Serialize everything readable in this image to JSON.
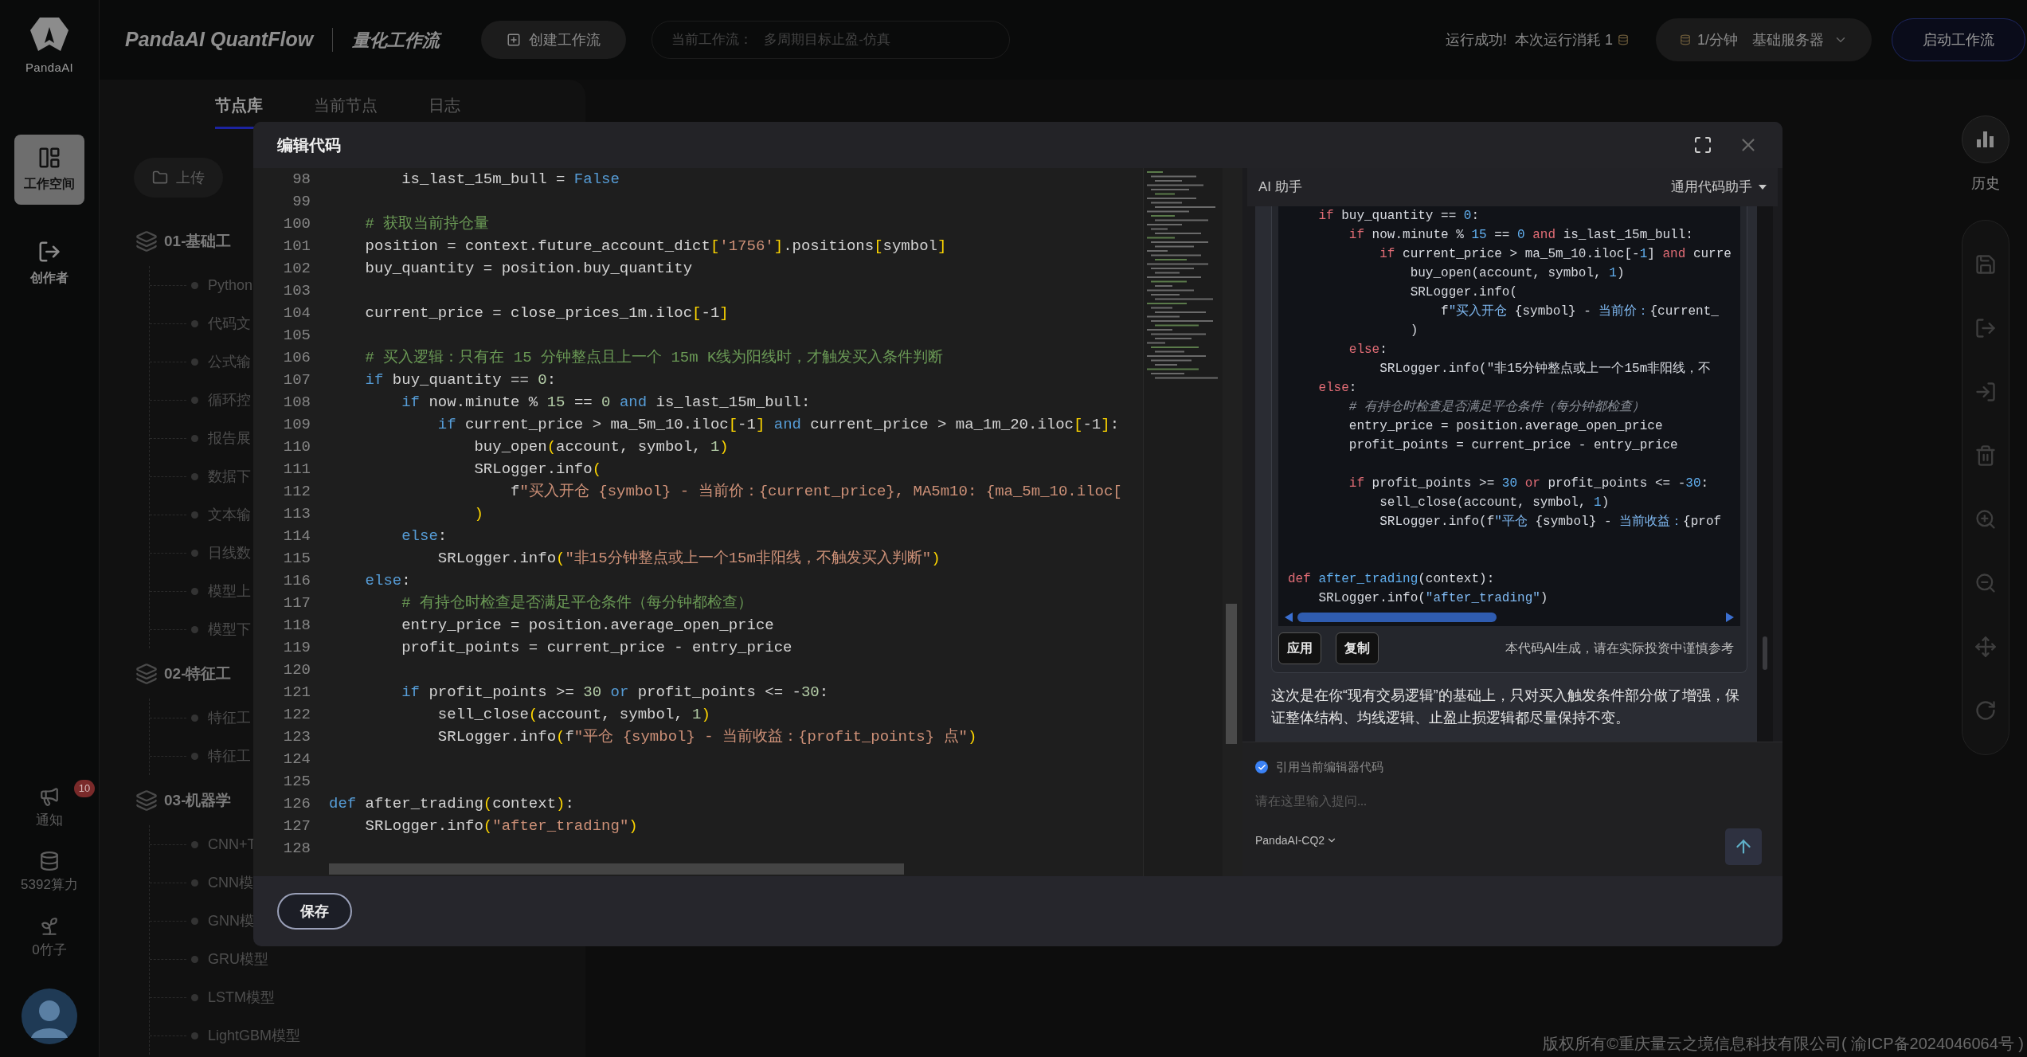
{
  "sidebar": {
    "logo_text": "PandaAI",
    "items": [
      {
        "label": "工作空间",
        "selected": true,
        "kind": "workspace"
      },
      {
        "label": "创作者",
        "selected": false,
        "kind": "creator"
      }
    ],
    "bottom_items": [
      {
        "kind": "notify",
        "label": "通知",
        "badge": "10"
      },
      {
        "kind": "compute",
        "label": "5392算力"
      },
      {
        "kind": "bamboo",
        "label": "0竹子"
      }
    ]
  },
  "header": {
    "title": "PandaAI QuantFlow",
    "subtitle": "量化工作流",
    "create_button": "创建工作流",
    "current_workflow": {
      "label": "当前工作流：",
      "value": "多周期目标止盈-仿真"
    },
    "run_status": "运行成功!  本次运行消耗 1",
    "server": {
      "rate": "1/分钟",
      "name": "基础服务器"
    },
    "start_button": "启动工作流"
  },
  "node_panel": {
    "tabs": [
      {
        "label": "节点库",
        "selected": true
      },
      {
        "label": "当前节点",
        "selected": false
      },
      {
        "label": "日志",
        "selected": false
      }
    ],
    "upload_button": "上传",
    "groups": [
      {
        "title": "01-基础工",
        "items": [
          "Python",
          "代码文",
          "公式输",
          "循环控",
          "报告展",
          "数据下",
          "文本输",
          "日线数",
          "模型上",
          "模型下"
        ]
      },
      {
        "title": "02-特征工",
        "items": [
          "特征工",
          "特征工"
        ]
      },
      {
        "title": "03-机器学",
        "items": [
          "CNN+T",
          "CNN模",
          "GNN模",
          "GRU模型",
          "LSTM模型",
          "LightGBM模型"
        ]
      }
    ]
  },
  "right_toolbar": {
    "history_label": "历史"
  },
  "dialog": {
    "title": "编辑代码",
    "editor": {
      "lines": [
        {
          "no": "98",
          "tokens": [
            {
              "kind": "plain",
              "text": "        is_last_15m_bull = "
            },
            {
              "kind": "kw",
              "text": "False"
            }
          ]
        },
        {
          "no": "99"
        },
        {
          "no": "100",
          "tokens": [
            {
              "kind": "cm",
              "text": "    # 获取当前持仓量"
            }
          ]
        },
        {
          "no": "101",
          "tokens": [
            {
              "kind": "plain",
              "text": "    position = context.future_account_dict"
            },
            {
              "kind": "br",
              "text": "["
            },
            {
              "kind": "str",
              "text": "'1756'"
            },
            {
              "kind": "br",
              "text": "]"
            },
            {
              "kind": "plain",
              "text": ".positions"
            },
            {
              "kind": "br",
              "text": "["
            },
            {
              "kind": "plain",
              "text": "symbol"
            },
            {
              "kind": "br",
              "text": "]"
            }
          ]
        },
        {
          "no": "102",
          "tokens": [
            {
              "kind": "plain",
              "text": "    buy_quantity = position.buy_quantity"
            }
          ]
        },
        {
          "no": "103"
        },
        {
          "no": "104",
          "tokens": [
            {
              "kind": "plain",
              "text": "    current_price = close_prices_1m.iloc"
            },
            {
              "kind": "br",
              "text": "["
            },
            {
              "kind": "plain",
              "text": "-1"
            },
            {
              "kind": "br",
              "text": "]"
            }
          ]
        },
        {
          "no": "105"
        },
        {
          "no": "106",
          "tokens": [
            {
              "kind": "cm",
              "text": "    # 买入逻辑：只有在 15 分钟整点且上一个 15m K线为阳线时，才触发买入条件判断"
            }
          ]
        },
        {
          "no": "107",
          "tokens": [
            {
              "kind": "kw",
              "text": "    if"
            },
            {
              "kind": "plain",
              "text": " buy_quantity == "
            },
            {
              "kind": "num",
              "text": "0"
            },
            {
              "kind": "plain",
              "text": ":"
            }
          ]
        },
        {
          "no": "108",
          "tokens": [
            {
              "kind": "kw",
              "text": "        if"
            },
            {
              "kind": "plain",
              "text": " now.minute % "
            },
            {
              "kind": "num",
              "text": "15"
            },
            {
              "kind": "plain",
              "text": " == "
            },
            {
              "kind": "num",
              "text": "0"
            },
            {
              "kind": "kw",
              "text": " and"
            },
            {
              "kind": "plain",
              "text": " is_last_15m_bull:"
            }
          ]
        },
        {
          "no": "109",
          "tokens": [
            {
              "kind": "kw",
              "text": "            if"
            },
            {
              "kind": "plain",
              "text": " current_price > ma_5m_10.iloc"
            },
            {
              "kind": "br",
              "text": "["
            },
            {
              "kind": "plain",
              "text": "-1"
            },
            {
              "kind": "br",
              "text": "]"
            },
            {
              "kind": "kw",
              "text": " and"
            },
            {
              "kind": "plain",
              "text": " current_price > ma_1m_20.iloc"
            },
            {
              "kind": "br",
              "text": "["
            },
            {
              "kind": "plain",
              "text": "-1"
            },
            {
              "kind": "br",
              "text": "]"
            },
            {
              "kind": "plain",
              "text": ":"
            }
          ]
        },
        {
          "no": "110",
          "tokens": [
            {
              "kind": "plain",
              "text": "                buy_open"
            },
            {
              "kind": "br",
              "text": "("
            },
            {
              "kind": "plain",
              "text": "account, symbol, "
            },
            {
              "kind": "num",
              "text": "1"
            },
            {
              "kind": "br",
              "text": ")"
            }
          ]
        },
        {
          "no": "111",
          "tokens": [
            {
              "kind": "plain",
              "text": "                SRLogger.info"
            },
            {
              "kind": "br",
              "text": "("
            }
          ]
        },
        {
          "no": "112",
          "tokens": [
            {
              "kind": "plain",
              "text": "                    f"
            },
            {
              "kind": "str",
              "text": "\"买入开仓 {symbol} - 当前价：{current_price}, MA5m10: {ma_5m_10.iloc["
            }
          ]
        },
        {
          "no": "113",
          "tokens": [
            {
              "kind": "br",
              "text": "                )"
            }
          ]
        },
        {
          "no": "114",
          "tokens": [
            {
              "kind": "kw",
              "text": "        else"
            },
            {
              "kind": "plain",
              "text": ":"
            }
          ]
        },
        {
          "no": "115",
          "tokens": [
            {
              "kind": "plain",
              "text": "            SRLogger.info"
            },
            {
              "kind": "br",
              "text": "("
            },
            {
              "kind": "str",
              "text": "\"非15分钟整点或上一个15m非阳线，不触发买入判断\""
            },
            {
              "kind": "br",
              "text": ")"
            }
          ]
        },
        {
          "no": "116",
          "tokens": [
            {
              "kind": "kw",
              "text": "    else"
            },
            {
              "kind": "plain",
              "text": ":"
            }
          ]
        },
        {
          "no": "117",
          "tokens": [
            {
              "kind": "cm",
              "text": "        # 有持仓时检查是否满足平仓条件（每分钟都检查）"
            }
          ]
        },
        {
          "no": "118",
          "tokens": [
            {
              "kind": "plain",
              "text": "        entry_price = position.average_open_price"
            }
          ]
        },
        {
          "no": "119",
          "tokens": [
            {
              "kind": "plain",
              "text": "        profit_points = current_price - entry_price"
            }
          ]
        },
        {
          "no": "120"
        },
        {
          "no": "121",
          "tokens": [
            {
              "kind": "kw",
              "text": "        if"
            },
            {
              "kind": "plain",
              "text": " profit_points >= "
            },
            {
              "kind": "num",
              "text": "30"
            },
            {
              "kind": "kw",
              "text": " or"
            },
            {
              "kind": "plain",
              "text": " profit_points <= -"
            },
            {
              "kind": "num",
              "text": "30"
            },
            {
              "kind": "plain",
              "text": ":"
            }
          ]
        },
        {
          "no": "122",
          "tokens": [
            {
              "kind": "plain",
              "text": "            sell_close"
            },
            {
              "kind": "br",
              "text": "("
            },
            {
              "kind": "plain",
              "text": "account, symbol, "
            },
            {
              "kind": "num",
              "text": "1"
            },
            {
              "kind": "br",
              "text": ")"
            }
          ]
        },
        {
          "no": "123",
          "tokens": [
            {
              "kind": "plain",
              "text": "            SRLogger.info"
            },
            {
              "kind": "br",
              "text": "("
            },
            {
              "kind": "plain",
              "text": "f"
            },
            {
              "kind": "str",
              "text": "\"平仓 {symbol} - 当前收益：{profit_points} 点\""
            },
            {
              "kind": "br",
              "text": ")"
            }
          ]
        },
        {
          "no": "124"
        },
        {
          "no": "125"
        },
        {
          "no": "126",
          "tokens": [
            {
              "kind": "kw",
              "text": "def"
            },
            {
              "kind": "plain",
              "text": " after_trading"
            },
            {
              "kind": "br",
              "text": "("
            },
            {
              "kind": "plain",
              "text": "context"
            },
            {
              "kind": "br",
              "text": ")"
            },
            {
              "kind": "plain",
              "text": ":"
            }
          ]
        },
        {
          "no": "127",
          "tokens": [
            {
              "kind": "plain",
              "text": "    SRLogger.info"
            },
            {
              "kind": "br",
              "text": "("
            },
            {
              "kind": "str",
              "text": "\"after_trading\""
            },
            {
              "kind": "br",
              "text": ")"
            }
          ]
        },
        {
          "no": "128"
        }
      ]
    },
    "assistant": {
      "title": "AI 助手",
      "mode": "通用代码助手",
      "code_lines": [
        {
          "kind": "code",
          "tokens": [
            {
              "kind": "kw",
              "text": "    if"
            },
            {
              "kind": "plain",
              "text": " buy_quantity == "
            },
            {
              "kind": "num",
              "text": "0"
            },
            {
              "kind": "plain",
              "text": ":"
            }
          ]
        },
        {
          "kind": "code",
          "tokens": [
            {
              "kind": "kw",
              "text": "        if"
            },
            {
              "kind": "plain",
              "text": " now.minute % "
            },
            {
              "kind": "num",
              "text": "15"
            },
            {
              "kind": "plain",
              "text": " == "
            },
            {
              "kind": "num",
              "text": "0"
            },
            {
              "kind": "kw",
              "text": " and"
            },
            {
              "kind": "plain",
              "text": " is_last_15m_bull:"
            }
          ]
        },
        {
          "kind": "code",
          "tokens": [
            {
              "kind": "kw",
              "text": "            if"
            },
            {
              "kind": "plain",
              "text": " current_price > ma_5m_10.iloc[-"
            },
            {
              "kind": "num",
              "text": "1"
            },
            {
              "kind": "plain",
              "text": "]"
            },
            {
              "kind": "kw",
              "text": " and"
            },
            {
              "kind": "plain",
              "text": " curre"
            }
          ]
        },
        {
          "kind": "code",
          "tokens": [
            {
              "kind": "plain",
              "text": "                buy_open(account, symbol, "
            },
            {
              "kind": "num",
              "text": "1"
            },
            {
              "kind": "plain",
              "text": ")"
            }
          ]
        },
        {
          "kind": "code",
          "tokens": [
            {
              "kind": "plain",
              "text": "                SRLogger.info("
            }
          ]
        },
        {
          "kind": "code",
          "tokens": [
            {
              "kind": "plain",
              "text": "                    f"
            },
            {
              "kind": "str",
              "text": "\"买入开仓"
            },
            {
              "kind": "plain",
              "text": " {symbol} - "
            },
            {
              "kind": "str",
              "text": "当前价："
            },
            {
              "kind": "plain",
              "text": "{current_"
            }
          ]
        },
        {
          "kind": "code",
          "tokens": [
            {
              "kind": "plain",
              "text": "                )"
            }
          ]
        },
        {
          "kind": "code",
          "tokens": [
            {
              "kind": "kw",
              "text": "        else"
            },
            {
              "kind": "plain",
              "text": ":"
            }
          ]
        },
        {
          "kind": "code",
          "tokens": [
            {
              "kind": "plain",
              "text": "            SRLogger.info(\"非15分钟整点或上一个15m非阳线，不"
            }
          ]
        },
        {
          "kind": "code",
          "tokens": [
            {
              "kind": "kw",
              "text": "    else"
            },
            {
              "kind": "plain",
              "text": ":"
            }
          ]
        },
        {
          "kind": "code",
          "tokens": [
            {
              "kind": "cm",
              "text": "        # 有持仓时检查是否满足平仓条件（每分钟都检查）"
            }
          ]
        },
        {
          "kind": "code",
          "tokens": [
            {
              "kind": "plain",
              "text": "        entry_price = position.average_open_price"
            }
          ]
        },
        {
          "kind": "code",
          "tokens": [
            {
              "kind": "plain",
              "text": "        profit_points = current_price - entry_price"
            }
          ]
        },
        {
          "kind": "blank"
        },
        {
          "kind": "code",
          "tokens": [
            {
              "kind": "kw",
              "text": "        if"
            },
            {
              "kind": "plain",
              "text": " profit_points >= "
            },
            {
              "kind": "num",
              "text": "30"
            },
            {
              "kind": "kw",
              "text": " or"
            },
            {
              "kind": "plain",
              "text": " profit_points <= -"
            },
            {
              "kind": "num",
              "text": "30"
            },
            {
              "kind": "plain",
              "text": ":"
            }
          ]
        },
        {
          "kind": "code",
          "tokens": [
            {
              "kind": "plain",
              "text": "            sell_close(account, symbol, "
            },
            {
              "kind": "num",
              "text": "1"
            },
            {
              "kind": "plain",
              "text": ")"
            }
          ]
        },
        {
          "kind": "code",
          "tokens": [
            {
              "kind": "plain",
              "text": "            SRLogger.info(f"
            },
            {
              "kind": "str",
              "text": "\"平仓"
            },
            {
              "kind": "plain",
              "text": " {symbol} - "
            },
            {
              "kind": "str",
              "text": "当前收益："
            },
            {
              "kind": "plain",
              "text": "{prof"
            }
          ]
        },
        {
          "kind": "blank"
        },
        {
          "kind": "blank"
        },
        {
          "kind": "code",
          "tokens": [
            {
              "kind": "kw",
              "text": "def"
            },
            {
              "kind": "fn",
              "text": " after_trading"
            },
            {
              "kind": "plain",
              "text": "(context):"
            }
          ]
        },
        {
          "kind": "code",
          "tokens": [
            {
              "kind": "plain",
              "text": "    SRLogger.info("
            },
            {
              "kind": "str",
              "text": "\"after_trading\""
            },
            {
              "kind": "plain",
              "text": ")"
            }
          ]
        }
      ],
      "apply_button": "应用",
      "copy_button": "复制",
      "disclaimer": "本代码AI生成，请在实际投资中谨慎参考",
      "message": "这次是在你“现有交易逻辑”的基础上，只对买入触发条件部分做了增强，保证整体结构、均线逻辑、止盈止损逻辑都尽量保持不变。",
      "quote_editor": {
        "label": "引用当前编辑器代码",
        "checked": true
      },
      "input": {
        "placeholder": "请在这里输入提问..."
      },
      "model": "PandaAI-CQ2"
    },
    "save_button": "保存"
  },
  "footer": "版权所有©重庆量云之境信息科技有限公司( 渝ICP备2024046064号 )"
}
